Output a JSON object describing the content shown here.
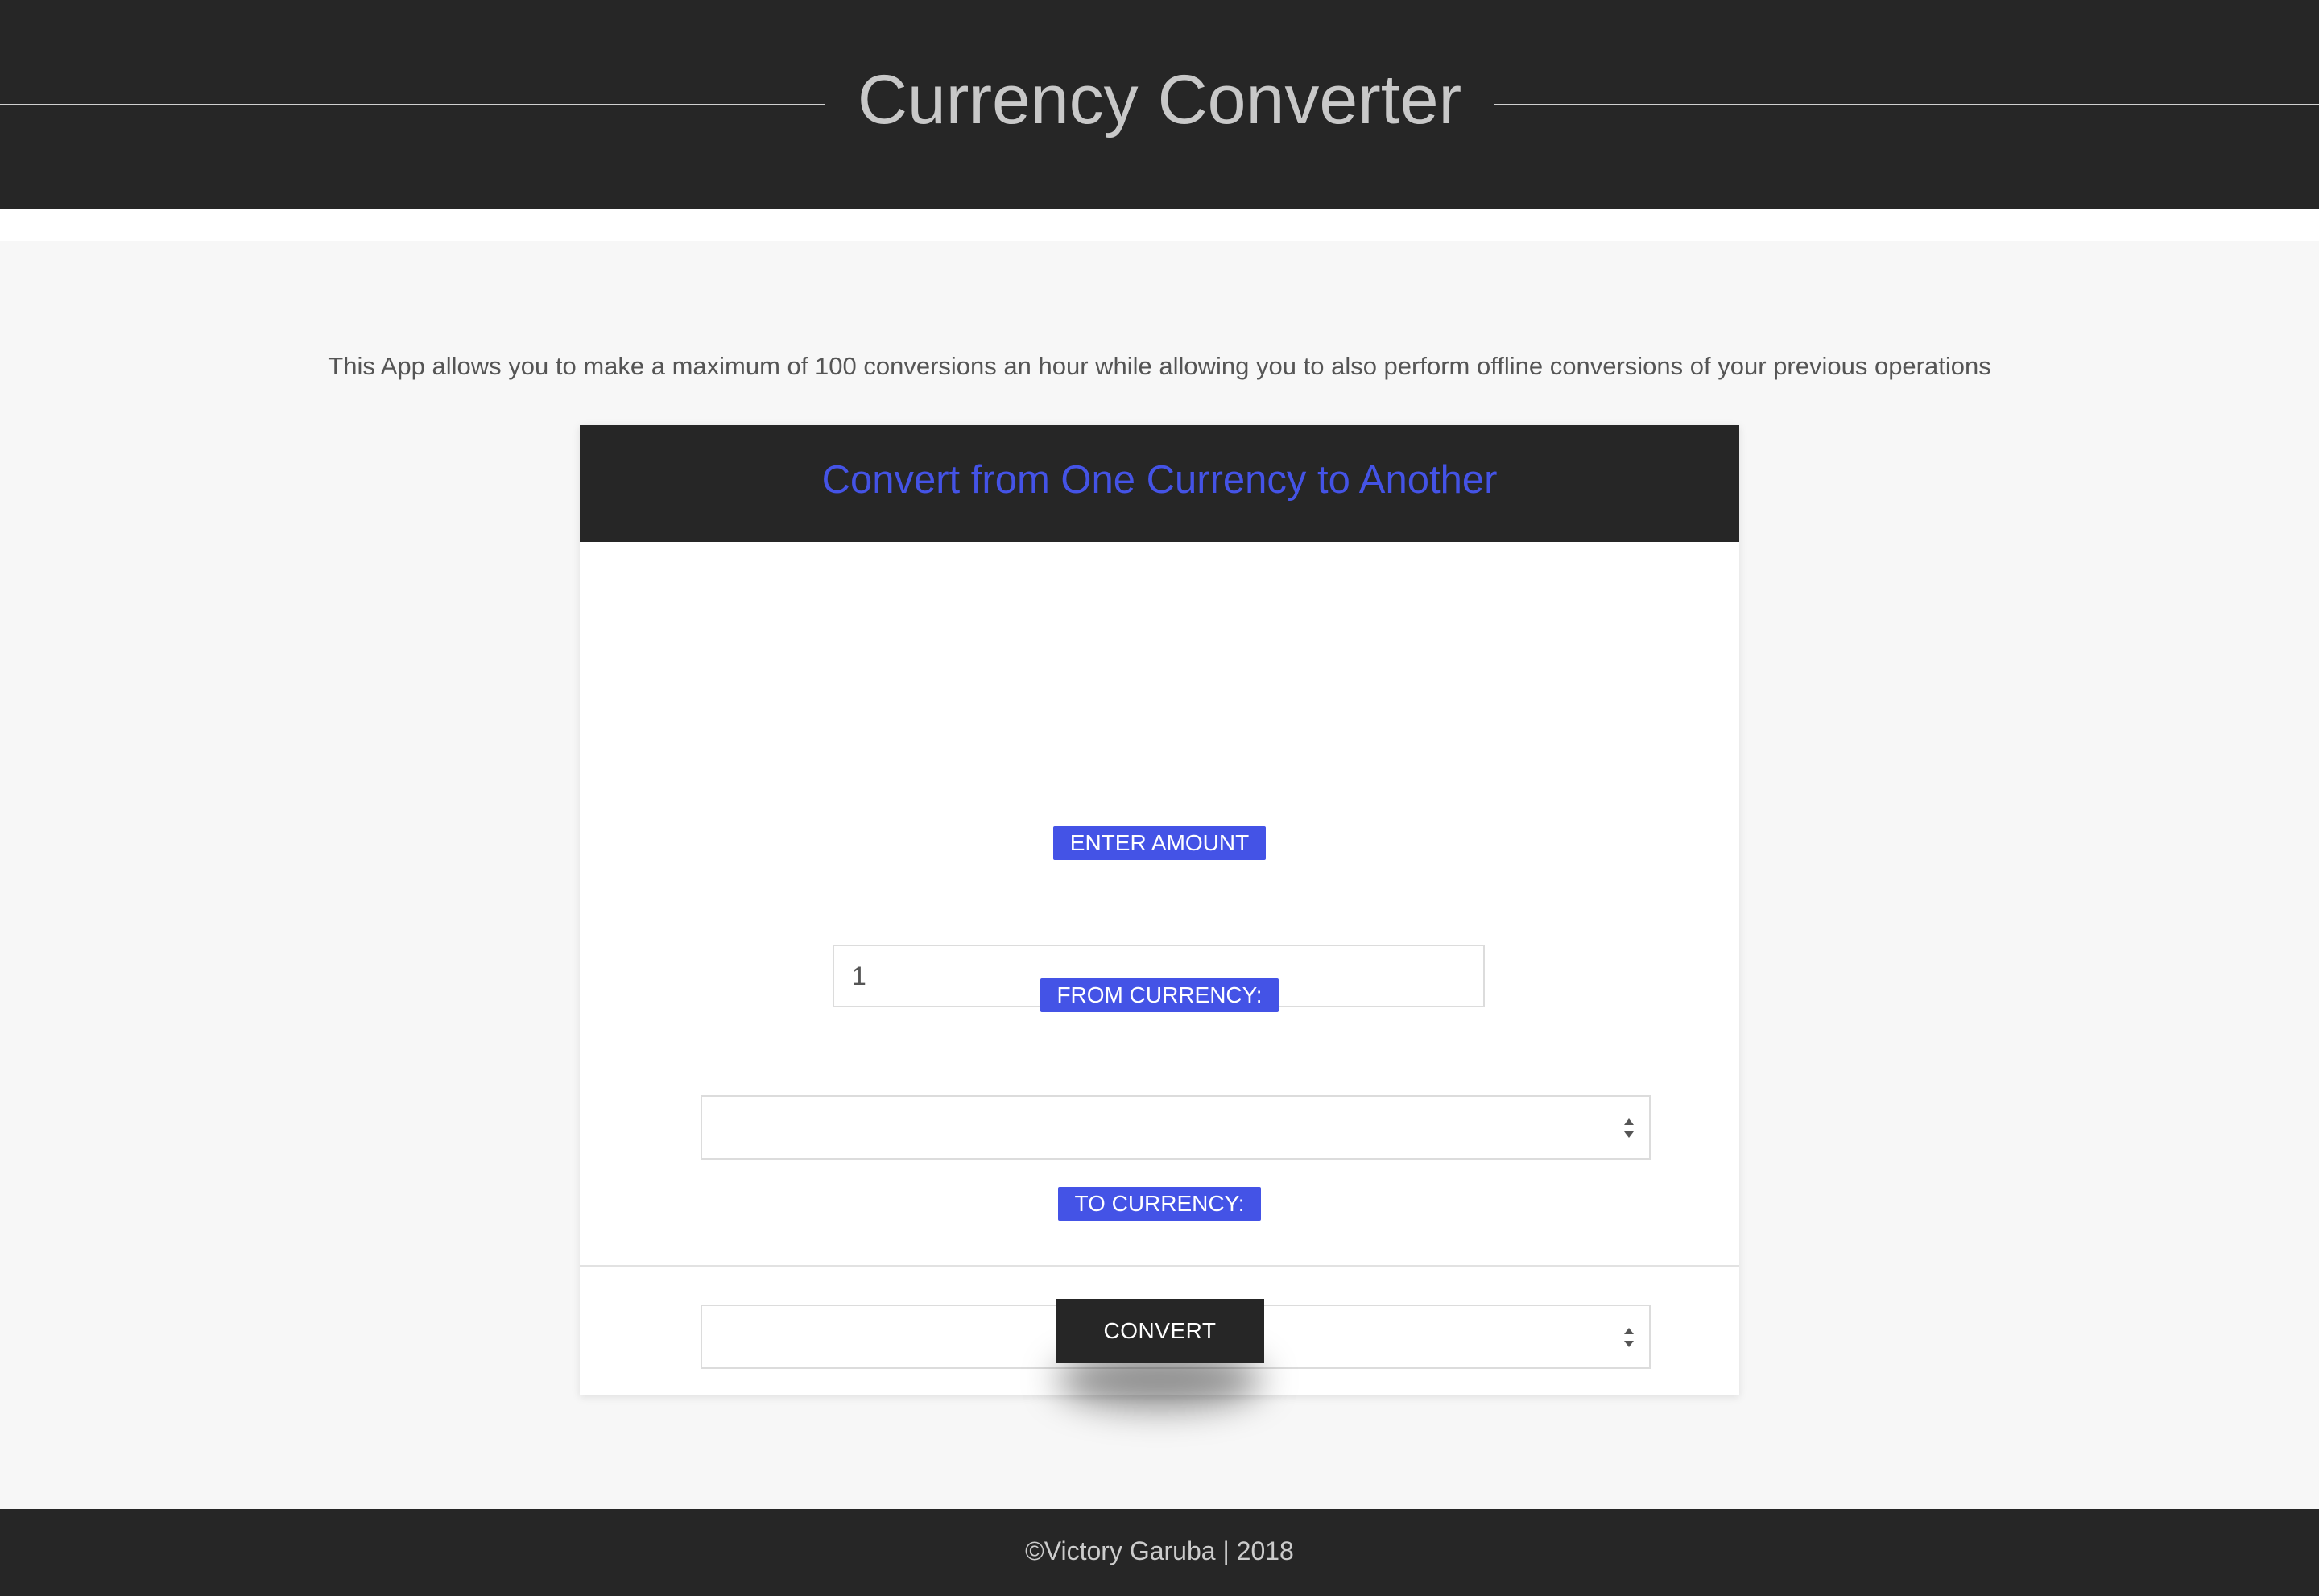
{
  "header": {
    "title": "Currency Converter"
  },
  "intro_text": "This App allows you to make a maximum of 100 conversions an hour while allowing you to also perform offline conversions of your previous operations",
  "card": {
    "title": "Convert from One Currency to Another",
    "amount_label": "ENTER AMOUNT",
    "amount_value": "1",
    "from_label": "FROM CURRENCY:",
    "from_value": "",
    "swap_icon": "↯",
    "to_label": "TO CURRENCY:",
    "to_value": "",
    "convert_label": "CONVERT"
  },
  "footer": {
    "text": "©Victory Garuba | 2018"
  },
  "colors": {
    "dark": "#262626",
    "accent": "#4453e6",
    "page_bg": "#f7f7f7"
  },
  "icons": {
    "swap": "swap-icon",
    "select_arrows": "select-arrows-icon"
  }
}
